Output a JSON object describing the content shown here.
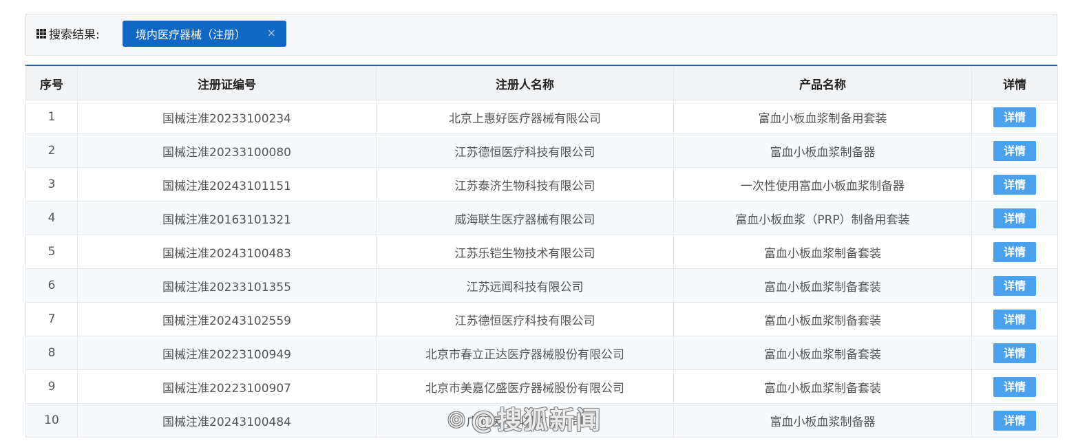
{
  "search": {
    "label": "搜索结果:",
    "tag_label": "境内医疗器械（注册）",
    "close_glyph": "×"
  },
  "table": {
    "headers": [
      "序号",
      "注册证编号",
      "注册人名称",
      "产品名称",
      "详情"
    ],
    "rows": [
      {
        "no": "1",
        "cert": "国械注准20233100234",
        "registrant": "北京上惠好医疗器械有限公司",
        "product": "富血小板血浆制备用套装",
        "action": "详情"
      },
      {
        "no": "2",
        "cert": "国械注准20233100080",
        "registrant": "江苏德恒医疗科技有限公司",
        "product": "富血小板血浆制备器",
        "action": "详情"
      },
      {
        "no": "3",
        "cert": "国械注准20243101151",
        "registrant": "江苏泰济生物科技有限公司",
        "product": "一次性使用富血小板血浆制备器",
        "action": "详情"
      },
      {
        "no": "4",
        "cert": "国械注准20163101321",
        "registrant": "威海联生医疗器械有限公司",
        "product": "富血小板血浆（PRP）制备用套装",
        "action": "详情"
      },
      {
        "no": "5",
        "cert": "国械注准20243100483",
        "registrant": "江苏乐铠生物技术有限公司",
        "product": "富血小板血浆制备套装",
        "action": "详情"
      },
      {
        "no": "6",
        "cert": "国械注准20233101355",
        "registrant": "江苏远闻科技有限公司",
        "product": "富血小板血浆制备套装",
        "action": "详情"
      },
      {
        "no": "7",
        "cert": "国械注准20243102559",
        "registrant": "江苏德恒医疗科技有限公司",
        "product": "富血小板血浆制备套装",
        "action": "详情"
      },
      {
        "no": "8",
        "cert": "国械注准20223100949",
        "registrant": "北京市春立正达医疗器械股份有限公司",
        "product": "富血小板血浆制备套装",
        "action": "详情"
      },
      {
        "no": "9",
        "cert": "国械注准20223100907",
        "registrant": "北京市美嘉亿盛医疗器械股份有限公司",
        "product": "富血小板血浆制备套装",
        "action": "详情"
      },
      {
        "no": "10",
        "cert": "国械注准20243100484",
        "registrant": "广汇医疗科技有限公司",
        "product": "富血小板血浆制备器",
        "action": "详情"
      }
    ]
  },
  "watermark": {
    "logo": "◎",
    "text": "@搜狐新闻"
  },
  "colors": {
    "tag_bg": "#1067c4",
    "button_bg": "#4aa2ef",
    "header_line": "#1a64b4"
  }
}
